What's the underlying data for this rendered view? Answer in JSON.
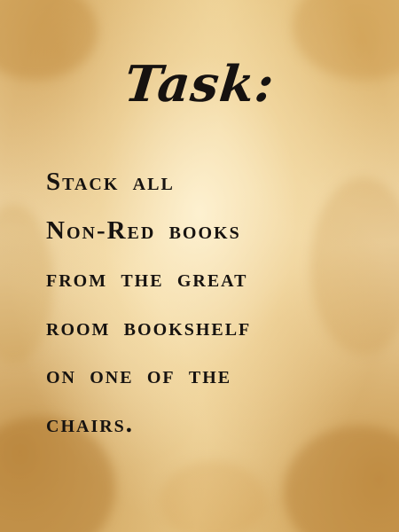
{
  "card": {
    "title": "Task:",
    "lines": [
      "Stack all",
      "Non-Red books",
      "from the great",
      "room bookshelf",
      "on one of the",
      "chairs."
    ]
  },
  "colors": {
    "parchment_light": "#f3ddb0",
    "parchment_dark": "#d4a050",
    "ink": "#171310"
  }
}
